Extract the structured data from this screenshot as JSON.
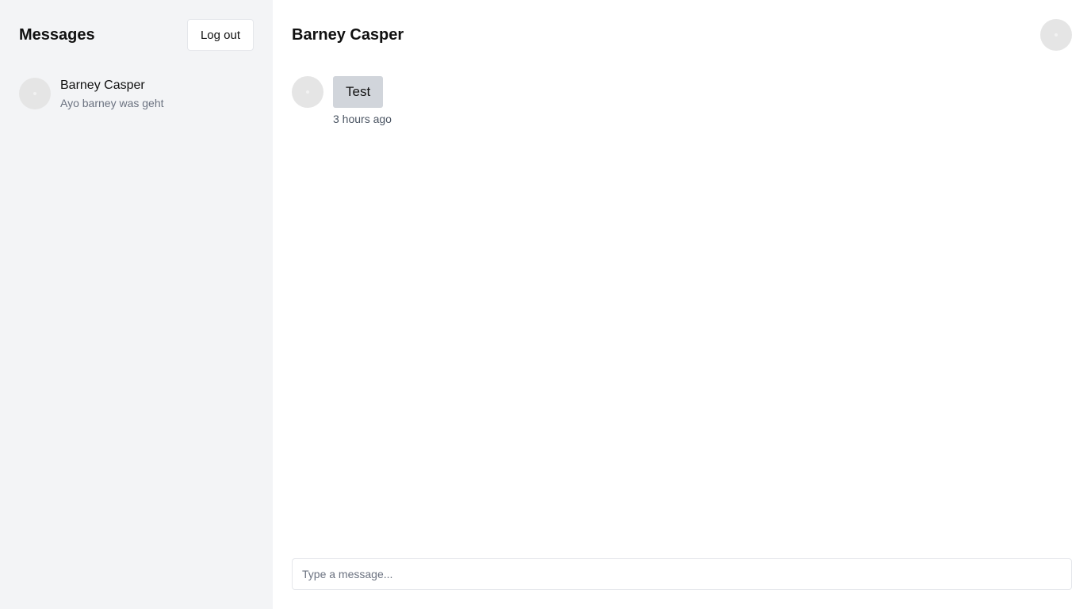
{
  "sidebar": {
    "title": "Messages",
    "logout_label": "Log out",
    "conversations": [
      {
        "name": "Barney Casper",
        "preview": "Ayo barney was geht"
      }
    ]
  },
  "chat": {
    "title": "Barney Casper",
    "messages": [
      {
        "text": "Test",
        "time": "3 hours ago"
      }
    ],
    "composer": {
      "placeholder": "Type a message...",
      "value": ""
    }
  },
  "colors": {
    "sidebar_bg": "#f3f4f6",
    "bubble_bg": "#d1d5db",
    "avatar_bg": "#e5e5e5",
    "muted_text": "#6b7280"
  }
}
